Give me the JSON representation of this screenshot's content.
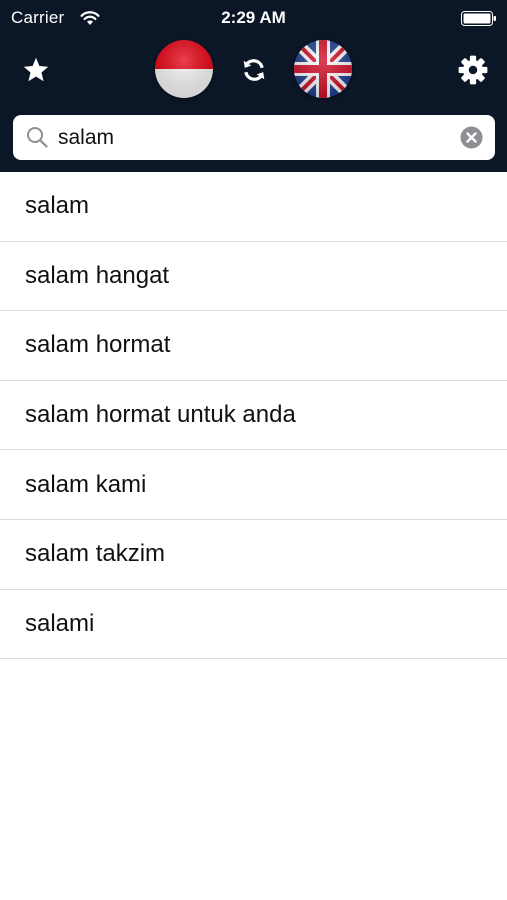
{
  "status_bar": {
    "carrier": "Carrier",
    "time": "2:29 AM"
  },
  "toolbar": {
    "favorites_icon": "star-icon",
    "source_language_flag": "indonesia-flag",
    "swap_icon": "refresh-icon",
    "target_language_flag": "uk-flag",
    "settings_icon": "gear-icon"
  },
  "search": {
    "value": "salam",
    "clear_icon": "clear-icon"
  },
  "results": [
    {
      "text": "salam"
    },
    {
      "text": "salam hangat"
    },
    {
      "text": "salam hormat"
    },
    {
      "text": "salam hormat untuk anda"
    },
    {
      "text": "salam kami"
    },
    {
      "text": "salam takzim"
    },
    {
      "text": "salami"
    }
  ],
  "colors": {
    "header_bg": "#0b1626",
    "divider": "#dcdcdc",
    "text": "#111111"
  }
}
